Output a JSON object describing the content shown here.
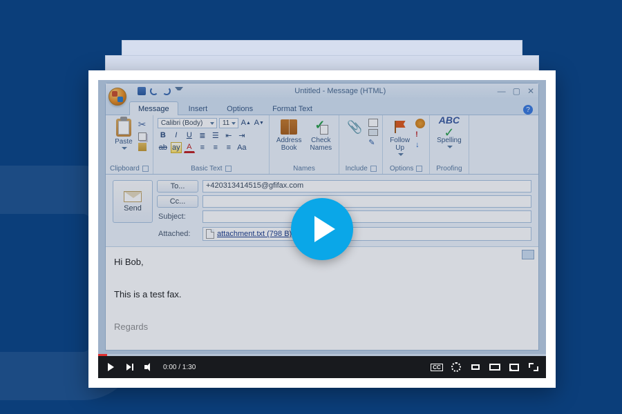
{
  "window": {
    "title": "Untitled - Message (HTML)",
    "tabs": {
      "message": "Message",
      "insert": "Insert",
      "options": "Options",
      "format": "Format Text"
    }
  },
  "ribbon": {
    "clipboard": {
      "paste": "Paste",
      "label": "Clipboard"
    },
    "basictext": {
      "font": "Calibri (Body)",
      "size": "11",
      "label": "Basic Text"
    },
    "names": {
      "address": "Address\nBook",
      "check": "Check\nNames",
      "label": "Names"
    },
    "include": {
      "label": "Include"
    },
    "options": {
      "follow": "Follow\nUp",
      "label": "Options"
    },
    "proofing": {
      "abc": "ABC",
      "spelling": "Spelling",
      "label": "Proofing"
    }
  },
  "compose": {
    "send": "Send",
    "to_label": "To...",
    "cc_label": "Cc...",
    "subject_label": "Subject:",
    "attached_label": "Attached:",
    "to_value": "+420313414515@gfifax.com",
    "cc_value": "",
    "subject_value": "",
    "attachment_name": "attachment.txt (798 B)"
  },
  "body": {
    "line1": "Hi Bob,",
    "line2": "This is a test fax.",
    "line3": "Regards"
  },
  "player": {
    "time": "0:00 / 1:30",
    "cc": "CC"
  }
}
